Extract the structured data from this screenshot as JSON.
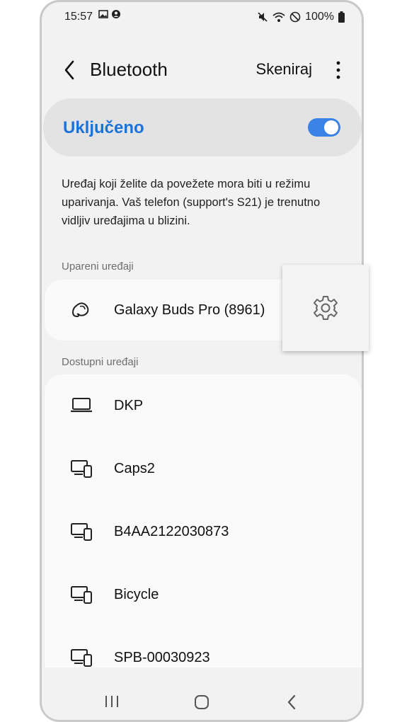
{
  "status_bar": {
    "time": "15:57",
    "battery": "100%",
    "left_icons": [
      "image-icon",
      "account-circle-icon"
    ],
    "right_icons": [
      "mute-icon",
      "wifi-icon",
      "do-not-disturb-icon",
      "battery-icon"
    ]
  },
  "header": {
    "title": "Bluetooth",
    "scan_label": "Skeniraj"
  },
  "toggle": {
    "label": "Uključeno",
    "state": "on",
    "accent": "#1a73d9"
  },
  "description": "Uređaj koji želite da povežete mora biti u režimu uparivanja. Vaš telefon (support's S21) je trenutno vidljiv uređajima u blizini.",
  "paired": {
    "section_label": "Upareni uređaji",
    "devices": [
      {
        "name": "Galaxy Buds Pro (8961)",
        "icon": "earbuds-icon"
      }
    ]
  },
  "available": {
    "section_label": "Dostupni uređaji",
    "devices": [
      {
        "name": "DKP",
        "icon": "laptop-icon"
      },
      {
        "name": "Caps2",
        "icon": "multi-device-icon"
      },
      {
        "name": "B4AA2122030873",
        "icon": "multi-device-icon"
      },
      {
        "name": "Bicycle",
        "icon": "multi-device-icon"
      },
      {
        "name": "SPB-00030923",
        "icon": "multi-device-icon"
      }
    ]
  },
  "nav": [
    "recents-icon",
    "home-icon",
    "back-icon"
  ]
}
